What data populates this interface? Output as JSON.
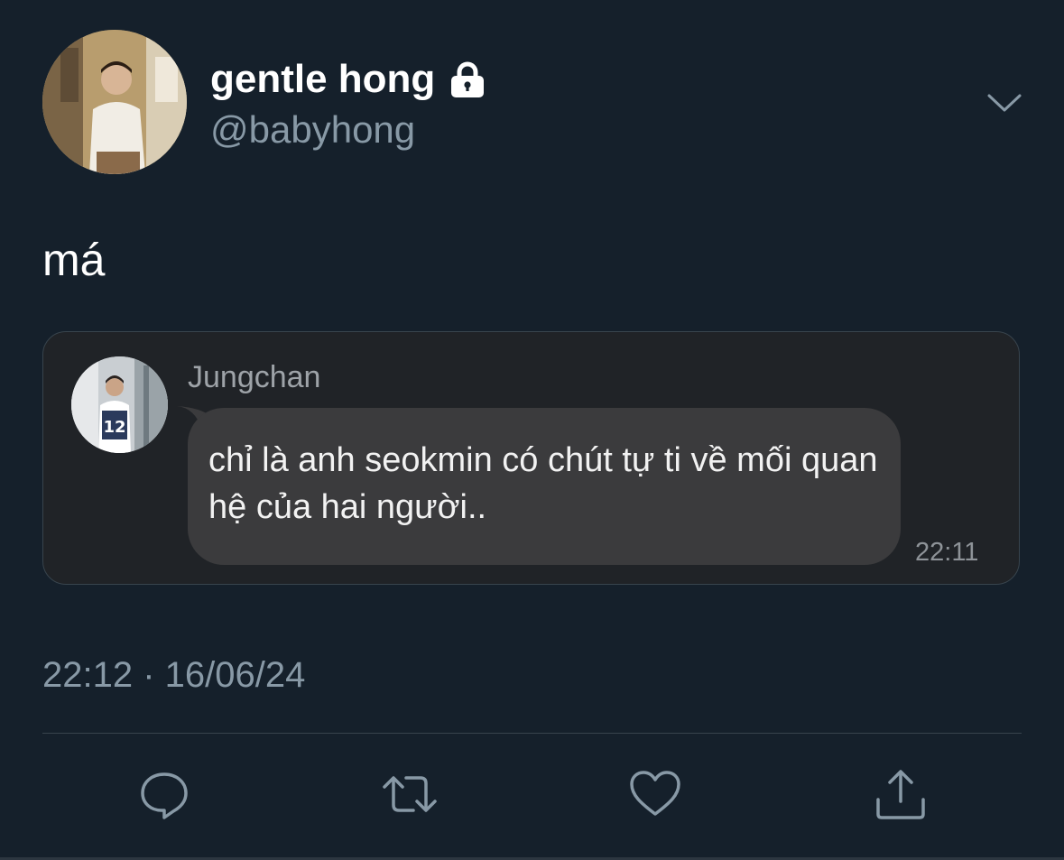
{
  "tweet": {
    "display_name": "gentle hong",
    "handle": "@babyhong",
    "text": "má",
    "timestamp": "22:12 · 16/06/24",
    "protected_icon": "lock-icon",
    "menu_icon": "chevron-down-icon"
  },
  "quoted_message": {
    "sender": "Jungchan",
    "message": "chỉ là anh seokmin có chút tự ti về mối quan hệ của hai người..",
    "time": "22:11"
  },
  "actions": [
    {
      "icon": "reply-icon"
    },
    {
      "icon": "retweet-icon"
    },
    {
      "icon": "like-icon"
    },
    {
      "icon": "share-icon"
    }
  ],
  "colors": {
    "background": "#15202b",
    "secondary_text": "#8899a6",
    "card_background": "#202327",
    "bubble": "#3b3b3d",
    "border": "#38444d"
  }
}
